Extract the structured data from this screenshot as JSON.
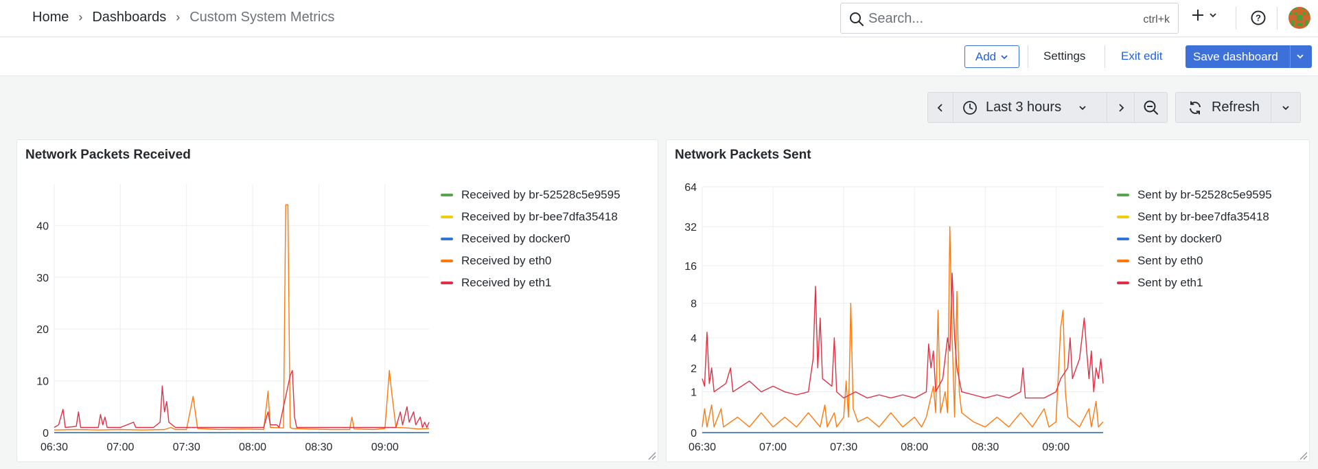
{
  "breadcrumb": {
    "home": "Home",
    "dashboards": "Dashboards",
    "current": "Custom System Metrics"
  },
  "search": {
    "placeholder": "Search...",
    "shortcut": "ctrl+k"
  },
  "editbar": {
    "add_label": "Add",
    "settings_label": "Settings",
    "exit_label": "Exit edit",
    "save_label": "Save dashboard"
  },
  "timepicker": {
    "range_label": "Last 3 hours",
    "refresh_label": "Refresh"
  },
  "colors": {
    "accent": "#3d71d9",
    "green": "#56a64b",
    "yellow": "#f2cc0c",
    "blue": "#3274d9",
    "orange": "#ff780a",
    "red": "#e02f44"
  },
  "panels": [
    {
      "title": "Network Packets Received",
      "legend": [
        {
          "label": "Received by br-52528c5e9595",
          "color": "#56a64b"
        },
        {
          "label": "Received by br-bee7dfa35418",
          "color": "#f2cc0c"
        },
        {
          "label": "Received by docker0",
          "color": "#3274d9"
        },
        {
          "label": "Received by eth0",
          "color": "#ff780a"
        },
        {
          "label": "Received by eth1",
          "color": "#e02f44"
        }
      ]
    },
    {
      "title": "Network Packets Sent",
      "legend": [
        {
          "label": "Sent by br-52528c5e9595",
          "color": "#56a64b"
        },
        {
          "label": "Sent by br-bee7dfa35418",
          "color": "#f2cc0c"
        },
        {
          "label": "Sent by docker0",
          "color": "#3274d9"
        },
        {
          "label": "Sent by eth0",
          "color": "#ff780a"
        },
        {
          "label": "Sent by eth1",
          "color": "#e02f44"
        }
      ]
    }
  ],
  "chart_data": [
    {
      "type": "line",
      "title": "Network Packets Received",
      "x_ticks": [
        "06:30",
        "07:00",
        "07:30",
        "08:00",
        "08:30",
        "09:00"
      ],
      "y_ticks": [
        0,
        10,
        20,
        30,
        40
      ],
      "ylim": [
        0,
        48
      ],
      "grid": true,
      "legend_position": "right",
      "series": [
        {
          "name": "Received by br-52528c5e9595",
          "color": "#56a64b",
          "points": [
            [
              "06:30",
              0
            ],
            [
              "09:20",
              0
            ]
          ]
        },
        {
          "name": "Received by br-bee7dfa35418",
          "color": "#f2cc0c",
          "points": [
            [
              "06:30",
              0
            ],
            [
              "09:20",
              0
            ]
          ]
        },
        {
          "name": "Received by docker0",
          "color": "#3274d9",
          "points": [
            [
              "06:30",
              0
            ],
            [
              "09:20",
              0
            ]
          ]
        },
        {
          "name": "Received by eth0",
          "color": "#ff780a",
          "points": [
            [
              "06:30",
              0.5
            ],
            [
              "06:40",
              0.6
            ],
            [
              "06:50",
              0.5
            ],
            [
              "07:00",
              0.6
            ],
            [
              "07:10",
              0.5
            ],
            [
              "07:20",
              0.6
            ],
            [
              "07:23",
              1
            ],
            [
              "07:25",
              0.6
            ],
            [
              "07:30",
              0.6
            ],
            [
              "07:33",
              7
            ],
            [
              "07:35",
              0.8
            ],
            [
              "07:45",
              0.6
            ],
            [
              "07:55",
              0.7
            ],
            [
              "08:05",
              0.6
            ],
            [
              "08:07",
              8
            ],
            [
              "08:08",
              1
            ],
            [
              "08:14",
              0.9
            ],
            [
              "08:15",
              44
            ],
            [
              "08:16",
              44
            ],
            [
              "08:17",
              1
            ],
            [
              "08:18",
              0.8
            ],
            [
              "08:25",
              0.7
            ],
            [
              "08:35",
              0.6
            ],
            [
              "08:44",
              0.6
            ],
            [
              "08:45",
              3
            ],
            [
              "08:46",
              0.7
            ],
            [
              "08:55",
              0.6
            ],
            [
              "09:00",
              0.8
            ],
            [
              "09:02",
              12
            ],
            [
              "09:03",
              8
            ],
            [
              "09:05",
              1
            ],
            [
              "09:10",
              0.9
            ],
            [
              "09:15",
              0.7
            ],
            [
              "09:20",
              0.8
            ]
          ]
        },
        {
          "name": "Received by eth1",
          "color": "#e02f44",
          "points": [
            [
              "06:30",
              1
            ],
            [
              "06:32",
              1.5
            ],
            [
              "06:34",
              4.5
            ],
            [
              "06:35",
              1
            ],
            [
              "06:40",
              1.2
            ],
            [
              "06:41",
              4
            ],
            [
              "06:42",
              1
            ],
            [
              "06:50",
              1
            ],
            [
              "06:51",
              3.5
            ],
            [
              "06:52",
              1.5
            ],
            [
              "06:53",
              3
            ],
            [
              "06:54",
              1
            ],
            [
              "07:00",
              1
            ],
            [
              "07:06",
              2
            ],
            [
              "07:07",
              1
            ],
            [
              "07:15",
              1
            ],
            [
              "07:18",
              2
            ],
            [
              "07:19",
              9
            ],
            [
              "07:20",
              4
            ],
            [
              "07:21",
              6
            ],
            [
              "07:22",
              2
            ],
            [
              "07:25",
              1
            ],
            [
              "07:30",
              1
            ],
            [
              "07:36",
              1
            ],
            [
              "07:40",
              1
            ],
            [
              "07:46",
              1
            ],
            [
              "07:50",
              1
            ],
            [
              "07:55",
              1
            ],
            [
              "08:05",
              1
            ],
            [
              "08:07",
              4
            ],
            [
              "08:08",
              1.5
            ],
            [
              "08:11",
              1.5
            ],
            [
              "08:12",
              1
            ],
            [
              "08:17",
              11
            ],
            [
              "08:18",
              12
            ],
            [
              "08:19",
              3
            ],
            [
              "08:20",
              1
            ],
            [
              "08:30",
              1
            ],
            [
              "08:40",
              1
            ],
            [
              "08:50",
              1
            ],
            [
              "09:00",
              1
            ],
            [
              "09:05",
              1
            ],
            [
              "09:07",
              4
            ],
            [
              "09:08",
              1.5
            ],
            [
              "09:10",
              5
            ],
            [
              "09:11",
              2
            ],
            [
              "09:13",
              4
            ],
            [
              "09:14",
              1.5
            ],
            [
              "09:16",
              3
            ],
            [
              "09:17",
              1
            ],
            [
              "09:18",
              2
            ],
            [
              "09:19",
              1
            ],
            [
              "09:20",
              2
            ]
          ]
        }
      ]
    },
    {
      "type": "line",
      "title": "Network Packets Sent",
      "x_ticks": [
        "06:30",
        "07:00",
        "07:30",
        "08:00",
        "08:30",
        "09:00"
      ],
      "y_ticks": [
        0,
        1,
        2,
        4,
        8,
        16,
        32,
        64
      ],
      "y_scale": "symlog",
      "ylim": [
        0,
        64
      ],
      "grid": true,
      "legend_position": "right",
      "series": [
        {
          "name": "Sent by br-52528c5e9595",
          "color": "#56a64b",
          "points": [
            [
              "06:30",
              0
            ],
            [
              "09:20",
              0
            ]
          ]
        },
        {
          "name": "Sent by br-bee7dfa35418",
          "color": "#f2cc0c",
          "points": [
            [
              "06:30",
              0
            ],
            [
              "09:20",
              0
            ]
          ]
        },
        {
          "name": "Sent by docker0",
          "color": "#3274d9",
          "points": [
            [
              "06:30",
              0
            ],
            [
              "09:20",
              0
            ]
          ]
        },
        {
          "name": "Sent by eth0",
          "color": "#ff780a",
          "points": [
            [
              "06:30",
              0.1
            ],
            [
              "06:31",
              0.5
            ],
            [
              "06:32",
              0.1
            ],
            [
              "06:34",
              0.6
            ],
            [
              "06:35",
              0.1
            ],
            [
              "06:38",
              0.5
            ],
            [
              "06:39",
              0.1
            ],
            [
              "06:45",
              0.3
            ],
            [
              "06:50",
              0.1
            ],
            [
              "06:55",
              0.4
            ],
            [
              "07:00",
              0.1
            ],
            [
              "07:05",
              0.3
            ],
            [
              "07:10",
              0.1
            ],
            [
              "07:15",
              0.4
            ],
            [
              "07:20",
              0.1
            ],
            [
              "07:22",
              0.6
            ],
            [
              "07:23",
              0.1
            ],
            [
              "07:26",
              0.4
            ],
            [
              "07:27",
              0.1
            ],
            [
              "07:30",
              0.3
            ],
            [
              "07:31",
              1.4
            ],
            [
              "07:32",
              0.3
            ],
            [
              "07:33",
              8
            ],
            [
              "07:34",
              0.5
            ],
            [
              "07:36",
              0.2
            ],
            [
              "07:40",
              0.3
            ],
            [
              "07:45",
              0.1
            ],
            [
              "07:50",
              0.4
            ],
            [
              "07:55",
              0.1
            ],
            [
              "08:00",
              0.3
            ],
            [
              "08:03",
              0.1
            ],
            [
              "08:05",
              0.3
            ],
            [
              "08:08",
              1.2
            ],
            [
              "08:09",
              0.4
            ],
            [
              "08:10",
              7
            ],
            [
              "08:11",
              0.4
            ],
            [
              "08:13",
              1
            ],
            [
              "08:14",
              0.4
            ],
            [
              "08:15",
              32
            ],
            [
              "08:16",
              4
            ],
            [
              "08:17",
              0.3
            ],
            [
              "08:18",
              10
            ],
            [
              "08:19",
              1
            ],
            [
              "08:20",
              0.4
            ],
            [
              "08:25",
              0.2
            ],
            [
              "08:30",
              0.1
            ],
            [
              "08:35",
              0.3
            ],
            [
              "08:40",
              0.1
            ],
            [
              "08:45",
              0.4
            ],
            [
              "08:50",
              0.1
            ],
            [
              "08:55",
              0.5
            ],
            [
              "08:57",
              0.1
            ],
            [
              "09:00",
              0.2
            ],
            [
              "09:02",
              5
            ],
            [
              "09:03",
              7
            ],
            [
              "09:04",
              1
            ],
            [
              "09:05",
              0.3
            ],
            [
              "09:10",
              0.1
            ],
            [
              "09:14",
              0.5
            ],
            [
              "09:15",
              0.1
            ],
            [
              "09:17",
              0.7
            ],
            [
              "09:18",
              0.1
            ],
            [
              "09:20",
              0.2
            ]
          ]
        },
        {
          "name": "Sent by eth1",
          "color": "#e02f44",
          "points": [
            [
              "06:30",
              1.5
            ],
            [
              "06:31",
              1.2
            ],
            [
              "06:32",
              4.5
            ],
            [
              "06:33",
              1.3
            ],
            [
              "06:34",
              2
            ],
            [
              "06:35",
              1
            ],
            [
              "06:40",
              1.3
            ],
            [
              "06:42",
              2
            ],
            [
              "06:43",
              1
            ],
            [
              "06:50",
              1.4
            ],
            [
              "06:55",
              1
            ],
            [
              "07:00",
              1.2
            ],
            [
              "07:05",
              1
            ],
            [
              "07:10",
              0.9
            ],
            [
              "07:15",
              1
            ],
            [
              "07:17",
              2.5
            ],
            [
              "07:18",
              11
            ],
            [
              "07:19",
              2
            ],
            [
              "07:20",
              6
            ],
            [
              "07:21",
              1.5
            ],
            [
              "07:25",
              1.2
            ],
            [
              "07:26",
              4
            ],
            [
              "07:27",
              1
            ],
            [
              "07:30",
              0.8
            ],
            [
              "07:35",
              1
            ],
            [
              "07:40",
              0.8
            ],
            [
              "07:45",
              0.9
            ],
            [
              "07:50",
              0.8
            ],
            [
              "07:55",
              0.9
            ],
            [
              "08:00",
              0.8
            ],
            [
              "08:05",
              1
            ],
            [
              "08:06",
              3.5
            ],
            [
              "08:07",
              2
            ],
            [
              "08:08",
              3
            ],
            [
              "08:09",
              1
            ],
            [
              "08:12",
              1.5
            ],
            [
              "08:14",
              4
            ],
            [
              "08:15",
              3
            ],
            [
              "08:16",
              14
            ],
            [
              "08:17",
              4
            ],
            [
              "08:18",
              2
            ],
            [
              "08:20",
              1
            ],
            [
              "08:25",
              0.9
            ],
            [
              "08:30",
              0.8
            ],
            [
              "08:35",
              0.9
            ],
            [
              "08:40",
              0.8
            ],
            [
              "08:45",
              1
            ],
            [
              "08:46",
              2
            ],
            [
              "08:47",
              0.8
            ],
            [
              "08:55",
              0.8
            ],
            [
              "09:00",
              1
            ],
            [
              "09:02",
              1.5
            ],
            [
              "09:05",
              2
            ],
            [
              "09:06",
              4
            ],
            [
              "09:07",
              1.5
            ],
            [
              "09:10",
              2.5
            ],
            [
              "09:12",
              6
            ],
            [
              "09:13",
              3
            ],
            [
              "09:14",
              1.5
            ],
            [
              "09:15",
              3
            ],
            [
              "09:16",
              1
            ],
            [
              "09:17",
              2
            ],
            [
              "09:18",
              1.5
            ],
            [
              "09:19",
              2.5
            ],
            [
              "09:20",
              1.3
            ]
          ]
        }
      ]
    }
  ]
}
